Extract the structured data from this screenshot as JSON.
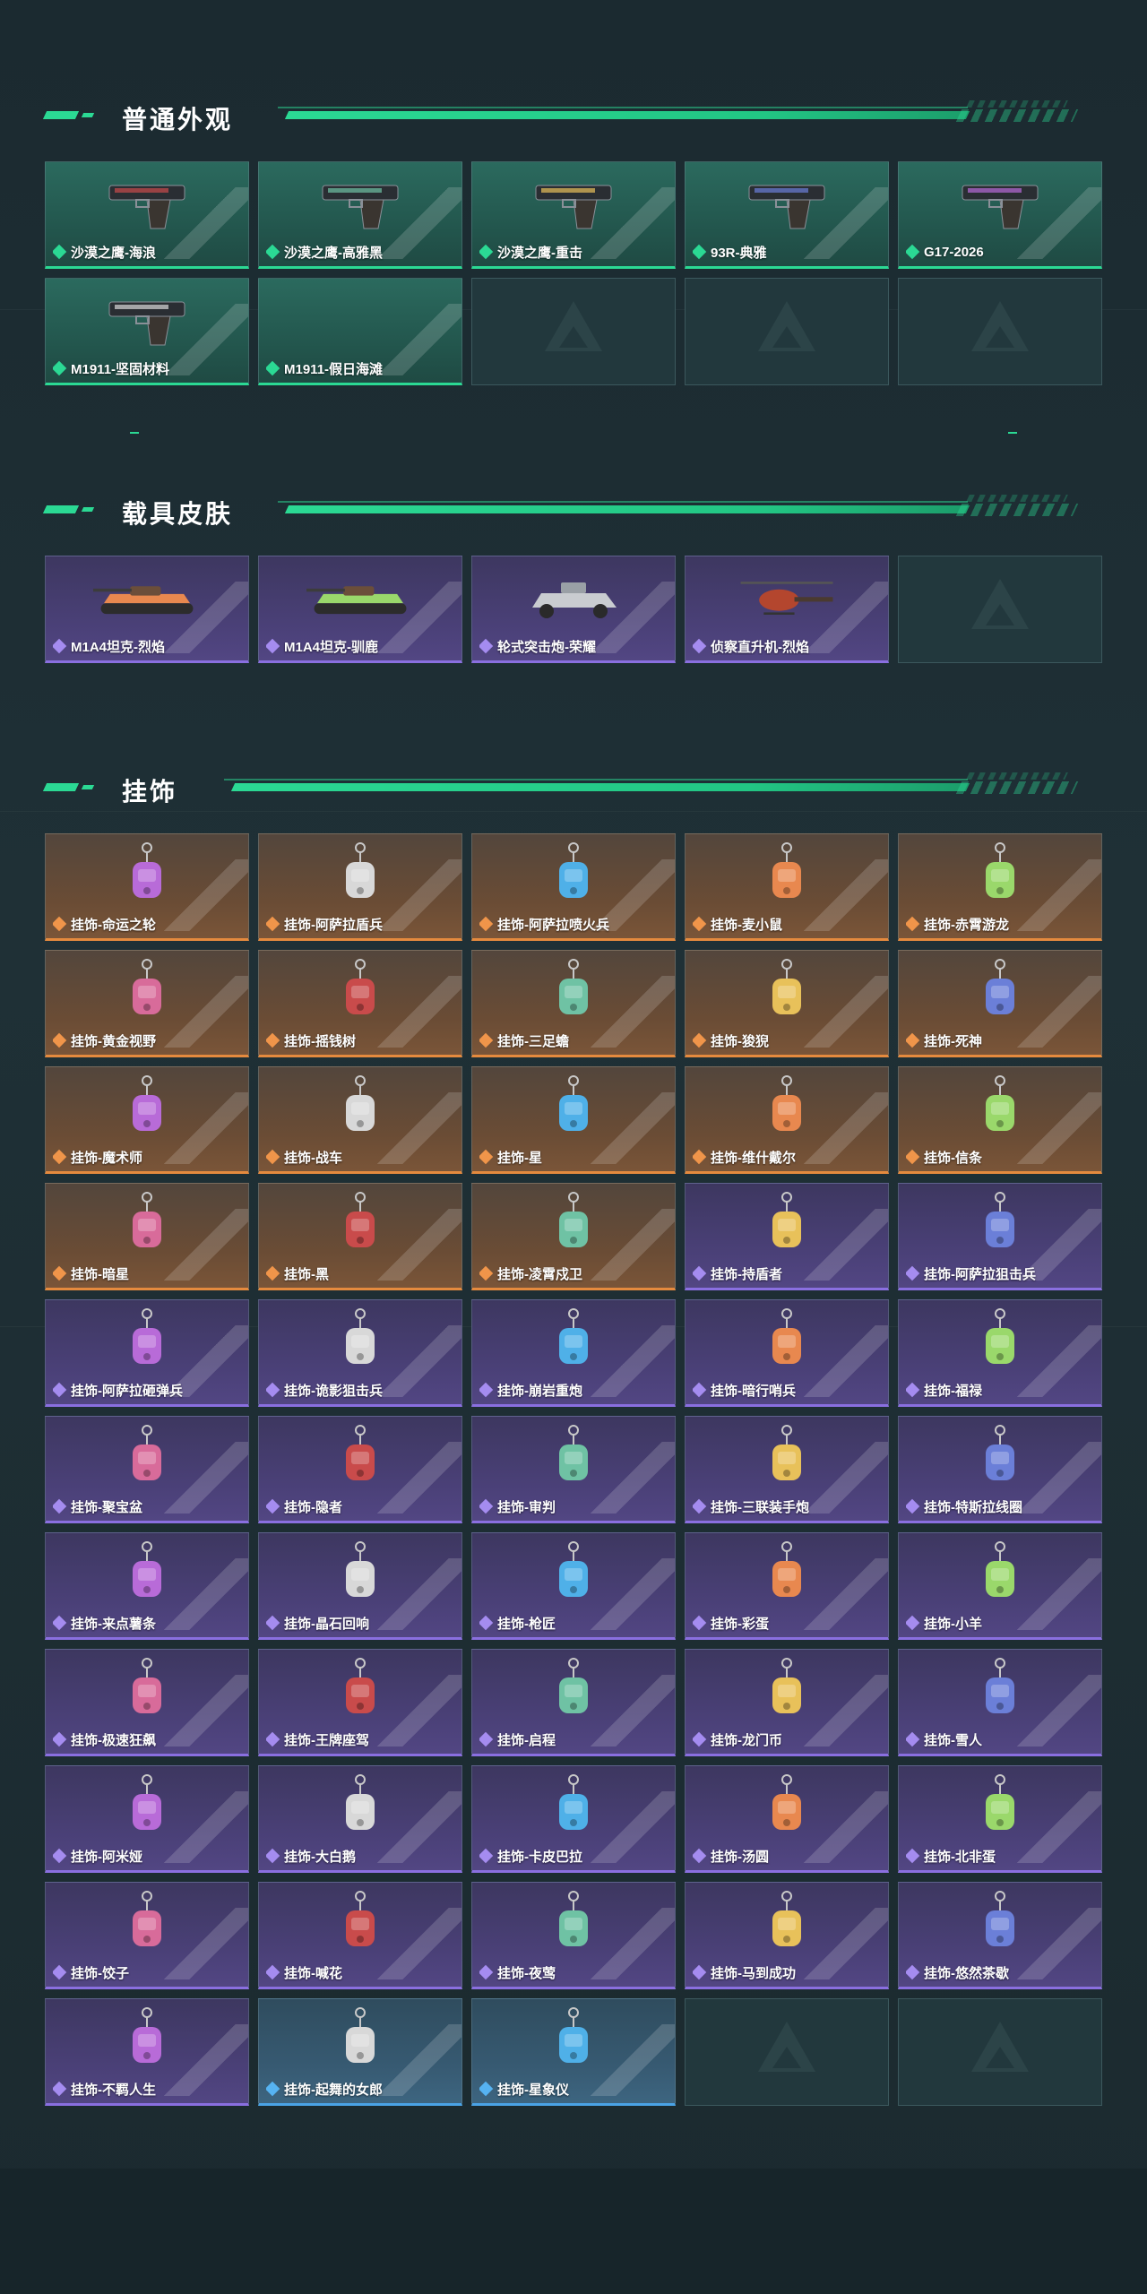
{
  "sections": [
    {
      "title": "普通外观",
      "items": [
        {
          "label": "沙漠之鹰-海浪",
          "tone": "green",
          "art": "pistol"
        },
        {
          "label": "沙漠之鹰-高雅黑",
          "tone": "green",
          "art": "pistol"
        },
        {
          "label": "沙漠之鹰-重击",
          "tone": "green",
          "art": "pistol"
        },
        {
          "label": "93R-典雅",
          "tone": "green",
          "art": "pistol"
        },
        {
          "label": "G17-2026",
          "tone": "green",
          "art": "pistol"
        },
        {
          "label": "M1911-坚固材料",
          "tone": "green",
          "art": "pistol"
        },
        {
          "label": "M1911-假日海滩",
          "tone": "green",
          "art": "none"
        },
        {
          "tone": "empty"
        },
        {
          "tone": "empty"
        },
        {
          "tone": "empty"
        }
      ]
    },
    {
      "title": "载具皮肤",
      "items": [
        {
          "label": "M1A4坦克-烈焰",
          "tone": "purple",
          "art": "tank"
        },
        {
          "label": "M1A4坦克-驯鹿",
          "tone": "purple",
          "art": "tank"
        },
        {
          "label": "轮式突击炮-荣耀",
          "tone": "purple",
          "art": "vehicle"
        },
        {
          "label": "侦察直升机-烈焰",
          "tone": "purple",
          "art": "heli"
        },
        {
          "tone": "empty"
        }
      ]
    },
    {
      "title": "挂饰",
      "items": [
        {
          "label": "挂饰-命运之轮",
          "tone": "orange",
          "art": "charm"
        },
        {
          "label": "挂饰-阿萨拉盾兵",
          "tone": "orange",
          "art": "charm"
        },
        {
          "label": "挂饰-阿萨拉喷火兵",
          "tone": "orange",
          "art": "charm"
        },
        {
          "label": "挂饰-麦小鼠",
          "tone": "orange",
          "art": "charm"
        },
        {
          "label": "挂饰-赤霄游龙",
          "tone": "orange",
          "art": "charm"
        },
        {
          "label": "挂饰-黄金视野",
          "tone": "orange",
          "art": "charm"
        },
        {
          "label": "挂饰-摇钱树",
          "tone": "orange",
          "art": "charm"
        },
        {
          "label": "挂饰-三足蟾",
          "tone": "orange",
          "art": "charm"
        },
        {
          "label": "挂饰-狻猊",
          "tone": "orange",
          "art": "charm"
        },
        {
          "label": "挂饰-死神",
          "tone": "orange",
          "art": "charm"
        },
        {
          "label": "挂饰-魔术师",
          "tone": "orange",
          "art": "charm"
        },
        {
          "label": "挂饰-战车",
          "tone": "orange",
          "art": "charm"
        },
        {
          "label": "挂饰-星",
          "tone": "orange",
          "art": "charm"
        },
        {
          "label": "挂饰-维什戴尔",
          "tone": "orange",
          "art": "charm"
        },
        {
          "label": "挂饰-信条",
          "tone": "orange",
          "art": "charm"
        },
        {
          "label": "挂饰-暗星",
          "tone": "orange",
          "art": "charm"
        },
        {
          "label": "挂饰-黑",
          "tone": "orange",
          "art": "charm"
        },
        {
          "label": "挂饰-凌霄戍卫",
          "tone": "orange",
          "art": "charm"
        },
        {
          "label": "挂饰-持盾者",
          "tone": "purple",
          "art": "charm"
        },
        {
          "label": "挂饰-阿萨拉狙击兵",
          "tone": "purple",
          "art": "charm"
        },
        {
          "label": "挂饰-阿萨拉砸弹兵",
          "tone": "purple",
          "art": "charm"
        },
        {
          "label": "挂饰-诡影狙击兵",
          "tone": "purple",
          "art": "charm"
        },
        {
          "label": "挂饰-崩岩重炮",
          "tone": "purple",
          "art": "charm"
        },
        {
          "label": "挂饰-暗行哨兵",
          "tone": "purple",
          "art": "charm"
        },
        {
          "label": "挂饰-福禄",
          "tone": "purple",
          "art": "charm"
        },
        {
          "label": "挂饰-聚宝盆",
          "tone": "purple",
          "art": "charm"
        },
        {
          "label": "挂饰-隐者",
          "tone": "purple",
          "art": "charm"
        },
        {
          "label": "挂饰-审判",
          "tone": "purple",
          "art": "charm"
        },
        {
          "label": "挂饰-三联装手炮",
          "tone": "purple",
          "art": "charm"
        },
        {
          "label": "挂饰-特斯拉线圈",
          "tone": "purple",
          "art": "charm"
        },
        {
          "label": "挂饰-来点薯条",
          "tone": "purple",
          "art": "charm"
        },
        {
          "label": "挂饰-晶石回响",
          "tone": "purple",
          "art": "charm"
        },
        {
          "label": "挂饰-枪匠",
          "tone": "purple",
          "art": "charm"
        },
        {
          "label": "挂饰-彩蛋",
          "tone": "purple",
          "art": "charm"
        },
        {
          "label": "挂饰-小羊",
          "tone": "purple",
          "art": "charm"
        },
        {
          "label": "挂饰-极速狂飙",
          "tone": "purple",
          "art": "charm"
        },
        {
          "label": "挂饰-王牌座驾",
          "tone": "purple",
          "art": "charm"
        },
        {
          "label": "挂饰-启程",
          "tone": "purple",
          "art": "charm"
        },
        {
          "label": "挂饰-龙门币",
          "tone": "purple",
          "art": "charm"
        },
        {
          "label": "挂饰-雪人",
          "tone": "purple",
          "art": "charm"
        },
        {
          "label": "挂饰-阿米娅",
          "tone": "purple",
          "art": "charm"
        },
        {
          "label": "挂饰-大白鹅",
          "tone": "purple",
          "art": "charm"
        },
        {
          "label": "挂饰-卡皮巴拉",
          "tone": "purple",
          "art": "charm"
        },
        {
          "label": "挂饰-汤圆",
          "tone": "purple",
          "art": "charm"
        },
        {
          "label": "挂饰-北非蛋",
          "tone": "purple",
          "art": "charm"
        },
        {
          "label": "挂饰-饺子",
          "tone": "purple",
          "art": "charm"
        },
        {
          "label": "挂饰-喊花",
          "tone": "purple",
          "art": "charm"
        },
        {
          "label": "挂饰-夜莺",
          "tone": "purple",
          "art": "charm"
        },
        {
          "label": "挂饰-马到成功",
          "tone": "purple",
          "art": "charm"
        },
        {
          "label": "挂饰-悠然茶歇",
          "tone": "purple",
          "art": "charm"
        },
        {
          "label": "挂饰-不羁人生",
          "tone": "purple",
          "art": "charm"
        },
        {
          "label": "挂饰-起舞的女郎",
          "tone": "blue",
          "art": "charm"
        },
        {
          "label": "挂饰-星象仪",
          "tone": "blue",
          "art": "charm"
        },
        {
          "tone": "empty"
        },
        {
          "tone": "empty"
        }
      ]
    }
  ],
  "colors": {
    "accent_green": "#2bd994",
    "rarity_green": "#2bd994",
    "rarity_purple": "#8a6fe0",
    "rarity_orange": "#e58a3e",
    "rarity_blue": "#4aa3e6"
  }
}
